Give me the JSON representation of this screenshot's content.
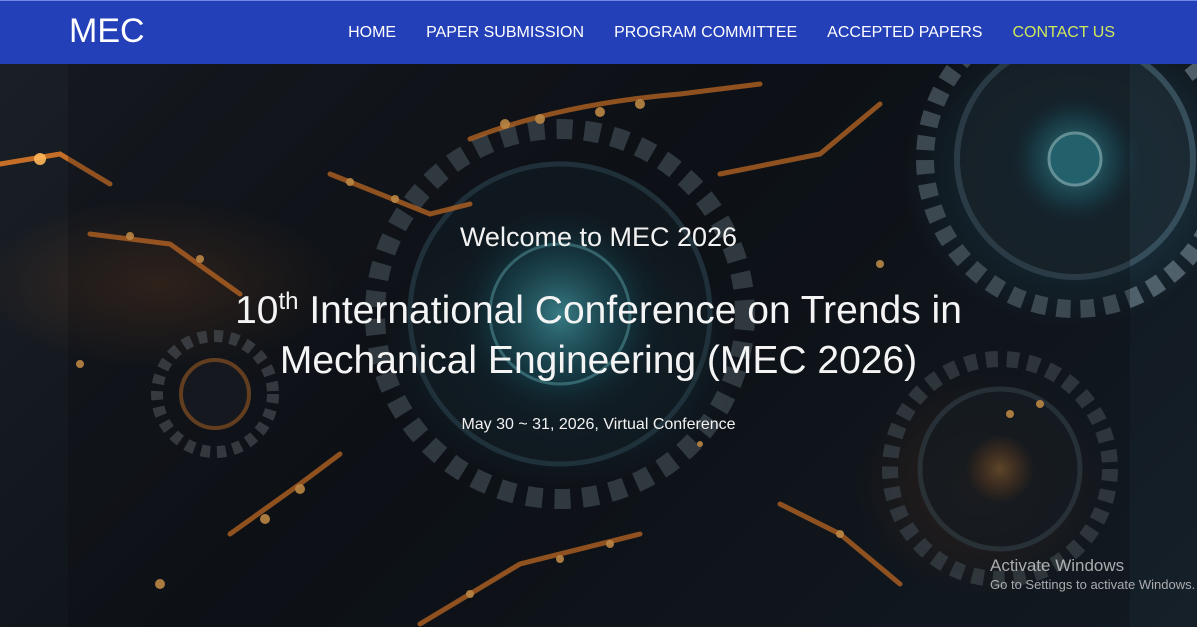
{
  "nav": {
    "brand": "MEC",
    "items": [
      {
        "label": "HOME"
      },
      {
        "label": "PAPER SUBMISSION"
      },
      {
        "label": "PROGRAM COMMITTEE"
      },
      {
        "label": "ACCEPTED PAPERS"
      },
      {
        "label": "CONTACT US"
      }
    ],
    "active_item": "CONTACT US",
    "bar_color": "#2440b8",
    "active_color": "#cfe85a"
  },
  "hero": {
    "welcome": "Welcome to MEC 2026",
    "title_ordinal": "10",
    "title_ordinal_suffix": "th",
    "title_rest": " International Conference on Trends in Mechanical Engineering (MEC 2026)",
    "date_location": "May 30 ~ 31, 2026, Virtual Conference",
    "background": "gears-circuit-image"
  },
  "watermark": {
    "title": "Activate Windows",
    "subtitle": "Go to Settings to activate Windows."
  }
}
